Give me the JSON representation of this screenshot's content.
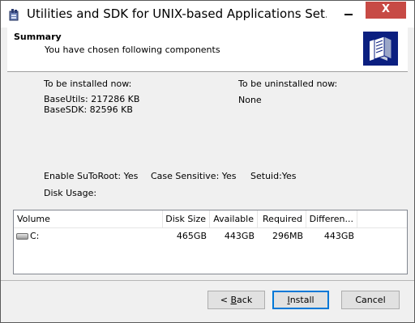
{
  "window": {
    "title": "Utilities and SDK for UNIX-based Applications Set...",
    "close_label": "X"
  },
  "header": {
    "title": "Summary",
    "subtitle": "You have chosen following components"
  },
  "install": {
    "heading": "To be installed now:",
    "items": [
      "BaseUtils:  217286 KB",
      "BaseSDK:  82596 KB"
    ]
  },
  "uninstall": {
    "heading": "To be uninstalled now:",
    "value": "None"
  },
  "options": {
    "sutoroot": "Enable SuToRoot: Yes",
    "case_sensitive": "Case Sensitive: Yes",
    "setuid": "Setuid:Yes"
  },
  "disk_usage_label": "Disk Usage:",
  "volume_table": {
    "columns": [
      "Volume",
      "Disk Size",
      "Available",
      "Required",
      "Differen..."
    ],
    "rows": [
      {
        "volume": "C:",
        "disk_size": "465GB",
        "available": "443GB",
        "required": "296MB",
        "difference": "443GB"
      }
    ]
  },
  "buttons": {
    "back_prefix": "< ",
    "back_hotkey": "B",
    "back_rest": "ack",
    "install_hotkey": "I",
    "install_rest": "nstall",
    "cancel": "Cancel"
  }
}
